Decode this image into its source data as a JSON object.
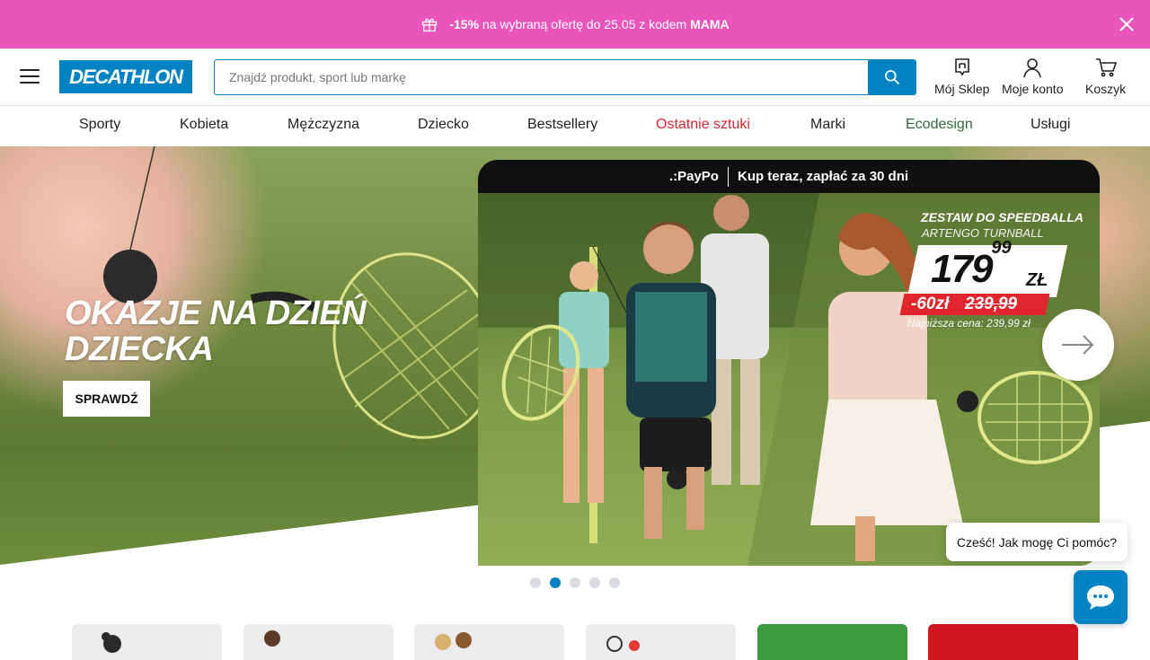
{
  "promo": {
    "discount": "-15%",
    "text_mid": " na wybraną ofertę do 25.05 z kodem ",
    "code": "MAMA"
  },
  "header": {
    "logo_text": "DECATHLON",
    "search_placeholder": "Znajdź produkt, sport lub markę",
    "icons": [
      {
        "label": "Mój Sklep",
        "icon": "store-icon"
      },
      {
        "label": "Moje konto",
        "icon": "user-icon"
      },
      {
        "label": "Koszyk",
        "icon": "cart-icon"
      }
    ]
  },
  "nav": {
    "items": [
      {
        "label": "Sporty"
      },
      {
        "label": "Kobieta"
      },
      {
        "label": "Mężczyzna"
      },
      {
        "label": "Dziecko"
      },
      {
        "label": "Bestsellery"
      },
      {
        "label": "Ostatnie sztuki",
        "color": "#d6262f"
      },
      {
        "label": "Marki"
      },
      {
        "label": "Ecodesign",
        "color": "#2f6b3c"
      },
      {
        "label": "Usługi"
      }
    ]
  },
  "hero": {
    "title": "OKAZJE NA DZIEŃ DZIECKA",
    "cta": "SPRAWDŹ",
    "card": {
      "paypo_brand": ".:PayPo",
      "paypo_text": "Kup teraz, zapłać za 30 dni",
      "product_title": "ZESTAW DO SPEEDBALLA",
      "product_sub": "ARTENGO TURNBALL",
      "price_main": "179",
      "price_cents": "99",
      "price_currency": "ZŁ",
      "discount": "-60zł",
      "old_price": "239,99",
      "lowest_price": "Najniższa cena: 239,99 zł"
    },
    "slides_count": 5,
    "active_slide": 2
  },
  "chat": {
    "greeting": "Cześć! Jak mogę Ci pomóc?"
  },
  "colors": {
    "brand": "#0082c3",
    "promo": "#ea55bc",
    "sale": "#d6262f"
  }
}
